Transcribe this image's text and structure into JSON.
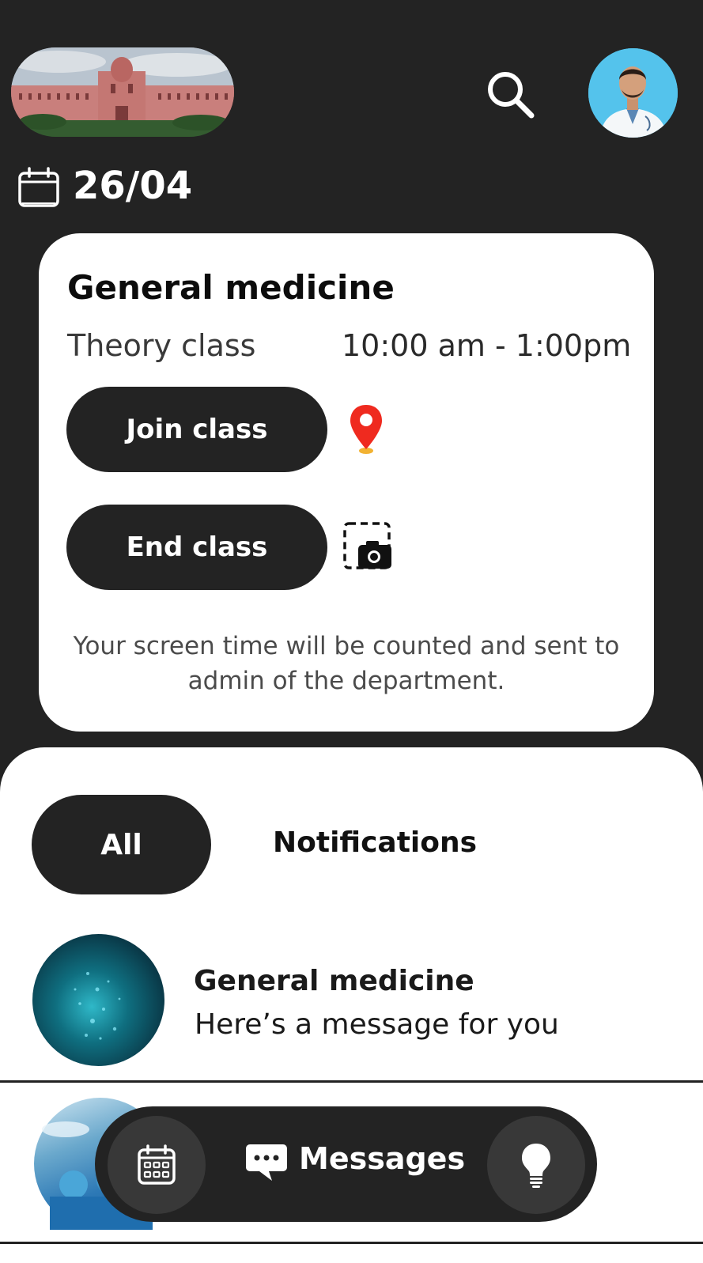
{
  "header": {
    "date": "26/04"
  },
  "class_card": {
    "title": "General medicine",
    "type": "Theory class",
    "time": "10:00 am - 1:00pm",
    "join_label": "Join class",
    "end_label": "End class",
    "note": "Your screen time will be counted and sent to admin of the department."
  },
  "tabs": [
    {
      "label": "All",
      "selected": true
    },
    {
      "label": "Notifications",
      "selected": false
    }
  ],
  "messages": [
    {
      "title": "General medicine",
      "text": "Here’s a message for you"
    },
    {
      "title": "",
      "text": ""
    }
  ],
  "bottom_nav": {
    "messages_label": "Messages",
    "icons": [
      "calendar-icon",
      "chat-icon",
      "lightbulb-icon"
    ]
  },
  "colors": {
    "background": "#232323",
    "card": "#ffffff",
    "pin": "#ef2a1f"
  }
}
